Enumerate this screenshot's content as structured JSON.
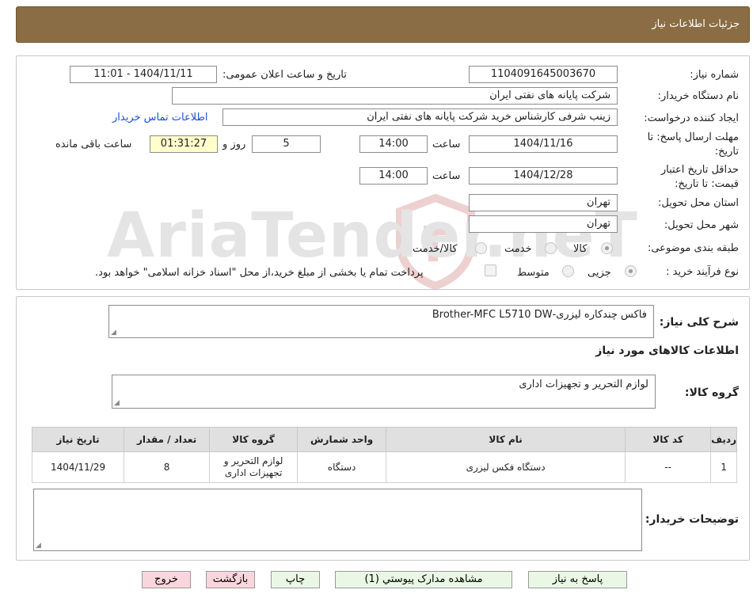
{
  "header": {
    "title": "جزئیات اطلاعات نیاز"
  },
  "form": {
    "need_number_label": "شماره نیاز:",
    "need_number": "1104091645003670",
    "announce_label": "تاریخ و ساعت اعلان عمومی:",
    "announce_value": "1404/11/11 - 11:01",
    "buyer_org_label": "نام دستگاه خریدار:",
    "buyer_org": "شرکت پایانه های نفتی ایران",
    "requester_label": "ایجاد کننده درخواست:",
    "requester": "زینب  شرفی  کارشناس خرید شرکت پایانه های نفتی ایران",
    "contact_link": "اطلاعات تماس خریدار",
    "reply_deadline_label": "مهلت ارسال پاسخ: تا تاریخ:",
    "reply_date": "1404/11/16",
    "time_label": "ساعت",
    "reply_time": "14:00",
    "days_value": "5",
    "days_label": "روز و",
    "remaining_time": "01:31:27",
    "remaining_label": "ساعت باقی مانده",
    "validity_label": "حداقل تاریخ اعتبار قیمت: تا تاریخ:",
    "validity_date": "1404/12/28",
    "validity_time": "14:00",
    "province_label": "استان محل تحویل:",
    "province": "تهران",
    "city_label": "شهر محل تحویل:",
    "city": "تهران",
    "category_label": "طبقه بندی موضوعی:",
    "category_options": [
      "کالا",
      "خدمت",
      "کالا/خدمت"
    ],
    "process_label": "نوع فرآیند خرید :",
    "process_options": [
      "جزیی",
      "متوسط"
    ],
    "payment_note": "پرداخت تمام یا بخشی از مبلغ خرید،از محل \"اسناد خزانه اسلامی\" خواهد بود."
  },
  "details": {
    "summary_label": "شرح کلی نیاز:",
    "summary": "فاکس چندکاره لیزری-Brother-MFC   L5710 DW",
    "goods_info_title": "اطلاعات کالاهای مورد نیاز",
    "goods_group_label": "گروه کالا:",
    "goods_group": "لوازم التحریر و تجهیزات اداری",
    "table": {
      "headers": [
        "ردیف",
        "کد کالا",
        "نام کالا",
        "واحد شمارش",
        "گروه کالا",
        "تعداد / مقدار",
        "تاریخ نیاز"
      ],
      "rows": [
        [
          "1",
          "--",
          "دستگاه فکس لیزری",
          "دستگاه",
          "لوازم التحریر و تجهیزات اداری",
          "8",
          "1404/11/29"
        ]
      ]
    },
    "buyer_notes_label": "توضیحات خریدار:"
  },
  "buttons": {
    "reply": "پاسخ به نیاز",
    "attachments": "مشاهده مدارک پیوستي (1)",
    "print": "چاپ",
    "back": "بازگشت",
    "exit": "خروج"
  },
  "watermark": {
    "text": "AriaTender.neT"
  },
  "colors": {
    "header_bg": "#8a6d44",
    "remaining_bg": "#ffffcc",
    "link": "#1a4fd6",
    "button_green": "#e9f7e4",
    "button_pink": "#f9d6de"
  }
}
